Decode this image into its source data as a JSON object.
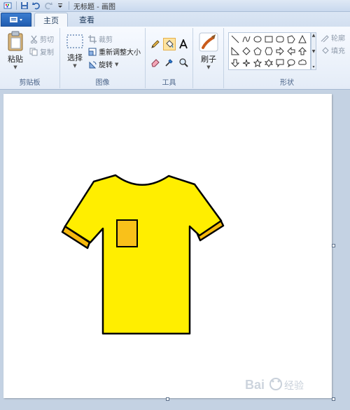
{
  "window": {
    "title": "无标题 - 画图"
  },
  "tabs": [
    {
      "label": "主页",
      "active": true
    },
    {
      "label": "查看",
      "active": false
    }
  ],
  "clipboard": {
    "paste_label": "粘贴",
    "cut_label": "剪切",
    "copy_label": "复制",
    "group_label": "剪贴板"
  },
  "image": {
    "select_label": "选择",
    "crop_label": "裁剪",
    "resize_label": "重新调整大小",
    "rotate_label": "旋转",
    "group_label": "图像"
  },
  "tools": {
    "group_label": "工具",
    "selected_tool": "fill"
  },
  "brushes": {
    "label": "刷子"
  },
  "shapes": {
    "group_label": "形状",
    "outline_label": "轮廓",
    "fill_label": "填充"
  },
  "drawing": {
    "shirt_color": "#ffee00",
    "cuff_color": "#f5b80d",
    "pocket_color": "#f9c11a",
    "outline_color": "#000000"
  },
  "watermark": {
    "text": "Bai 经验"
  },
  "colors": {
    "accent": "#1f5cb0",
    "selected_tool_bg": "#fde3a0"
  }
}
